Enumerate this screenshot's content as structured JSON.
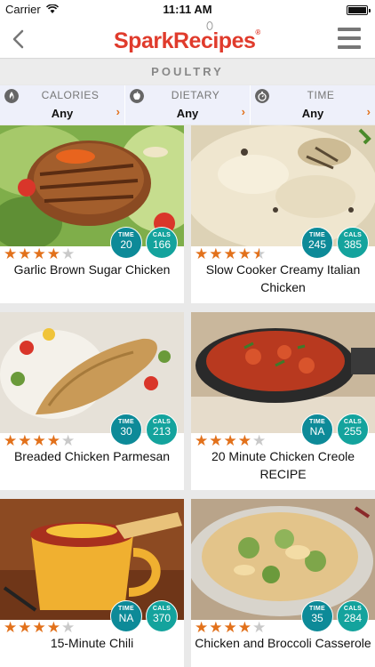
{
  "status_bar": {
    "carrier": "Carrier",
    "time": "11:11 AM"
  },
  "nav": {
    "logo_part1": "Spark",
    "logo_part2": "Recipes",
    "logo_mark": "®"
  },
  "category": {
    "title": "POULTRY"
  },
  "filters": [
    {
      "label": "CALORIES",
      "value": "Any",
      "icon": "calories-icon"
    },
    {
      "label": "DIETARY",
      "value": "Any",
      "icon": "apple-icon"
    },
    {
      "label": "TIME",
      "value": "Any",
      "icon": "stopwatch-icon"
    }
  ],
  "badge_labels": {
    "time": "TIME",
    "cals": "CALS"
  },
  "recipes": [
    {
      "title": "Garlic Brown Sugar Chicken",
      "time": "20",
      "cals": "166",
      "rating": 4,
      "image": "grilled-chicken-salad"
    },
    {
      "title": "Slow Cooker Creamy Italian Chicken",
      "time": "245",
      "cals": "385",
      "rating": 4.5,
      "image": "creamy-pasta-chicken"
    },
    {
      "title": "Breaded Chicken Parmesan",
      "time": "30",
      "cals": "213",
      "rating": 4,
      "image": "breaded-chicken"
    },
    {
      "title": "20 Minute Chicken Creole RECIPE",
      "time": "NA",
      "cals": "255",
      "rating": 4,
      "image": "chicken-creole-skillet"
    },
    {
      "title": "15-Minute Chili",
      "time": "NA",
      "cals": "370",
      "rating": 4,
      "image": "chili-mug"
    },
    {
      "title": "Chicken and Broccoli Casserole",
      "time": "35",
      "cals": "284",
      "rating": 4,
      "image": "broccoli-casserole"
    }
  ],
  "colors": {
    "brand_red": "#e03b2c",
    "accent_orange": "#e2711b",
    "badge_teal": "#0d8a98"
  }
}
